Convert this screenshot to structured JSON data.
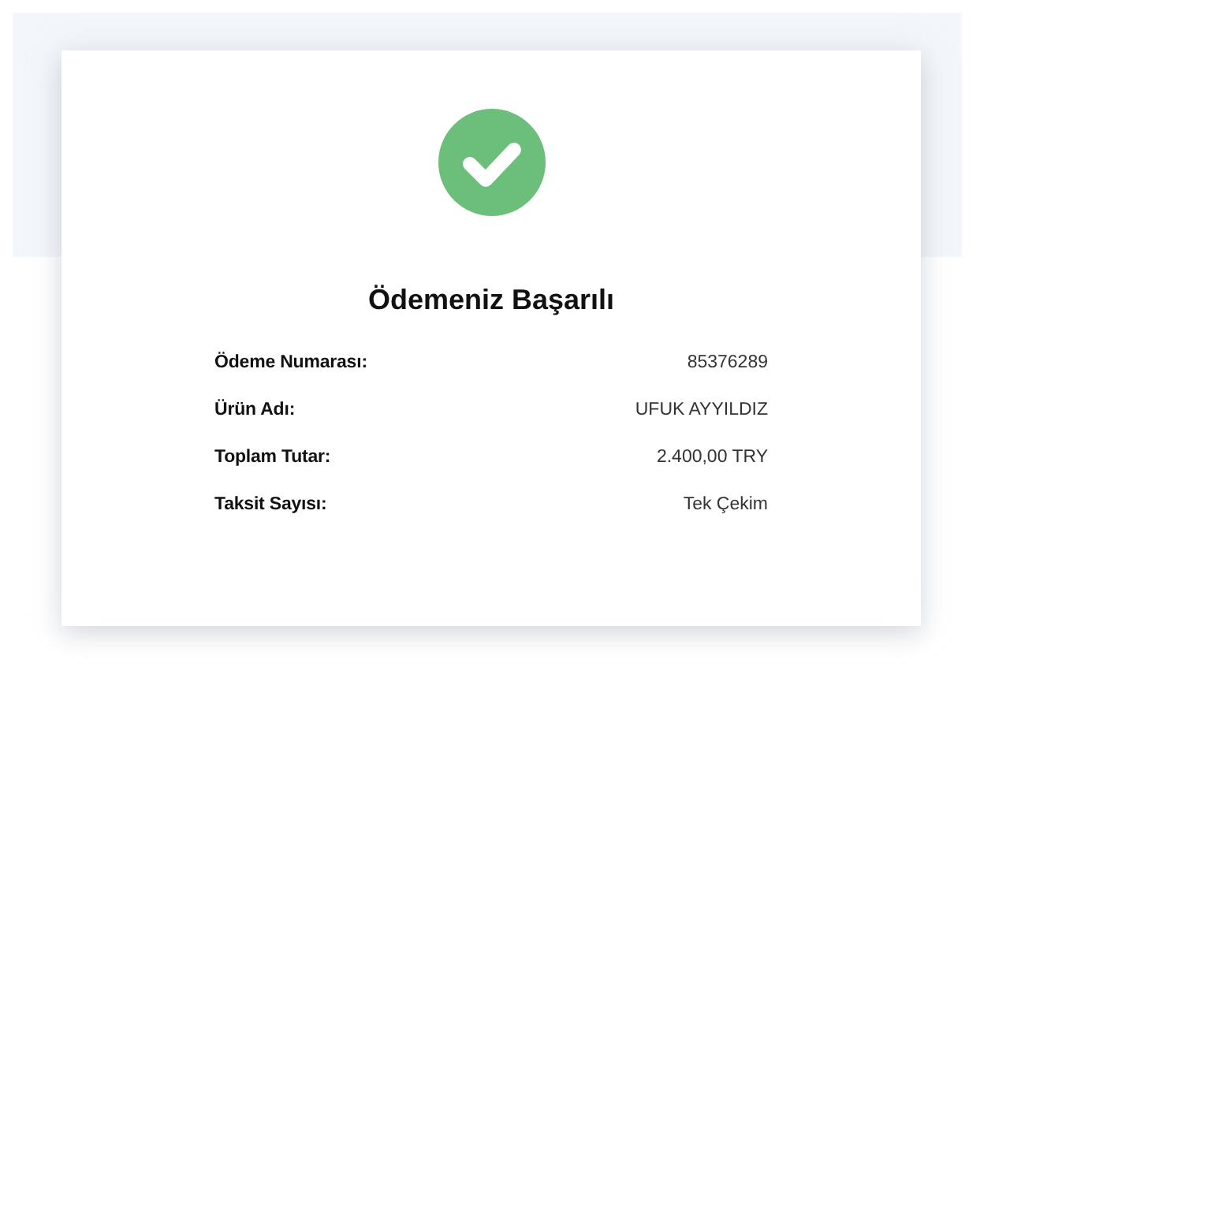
{
  "title": "Ödemeniz Başarılı",
  "details": [
    {
      "label": "Ödeme Numarası:",
      "value": "85376289"
    },
    {
      "label": "Ürün Adı:",
      "value": "UFUK AYYILDIZ"
    },
    {
      "label": "Toplam Tutar:",
      "value": "2.400,00 TRY"
    },
    {
      "label": "Taksit Sayısı:",
      "value": "Tek Çekim"
    }
  ]
}
